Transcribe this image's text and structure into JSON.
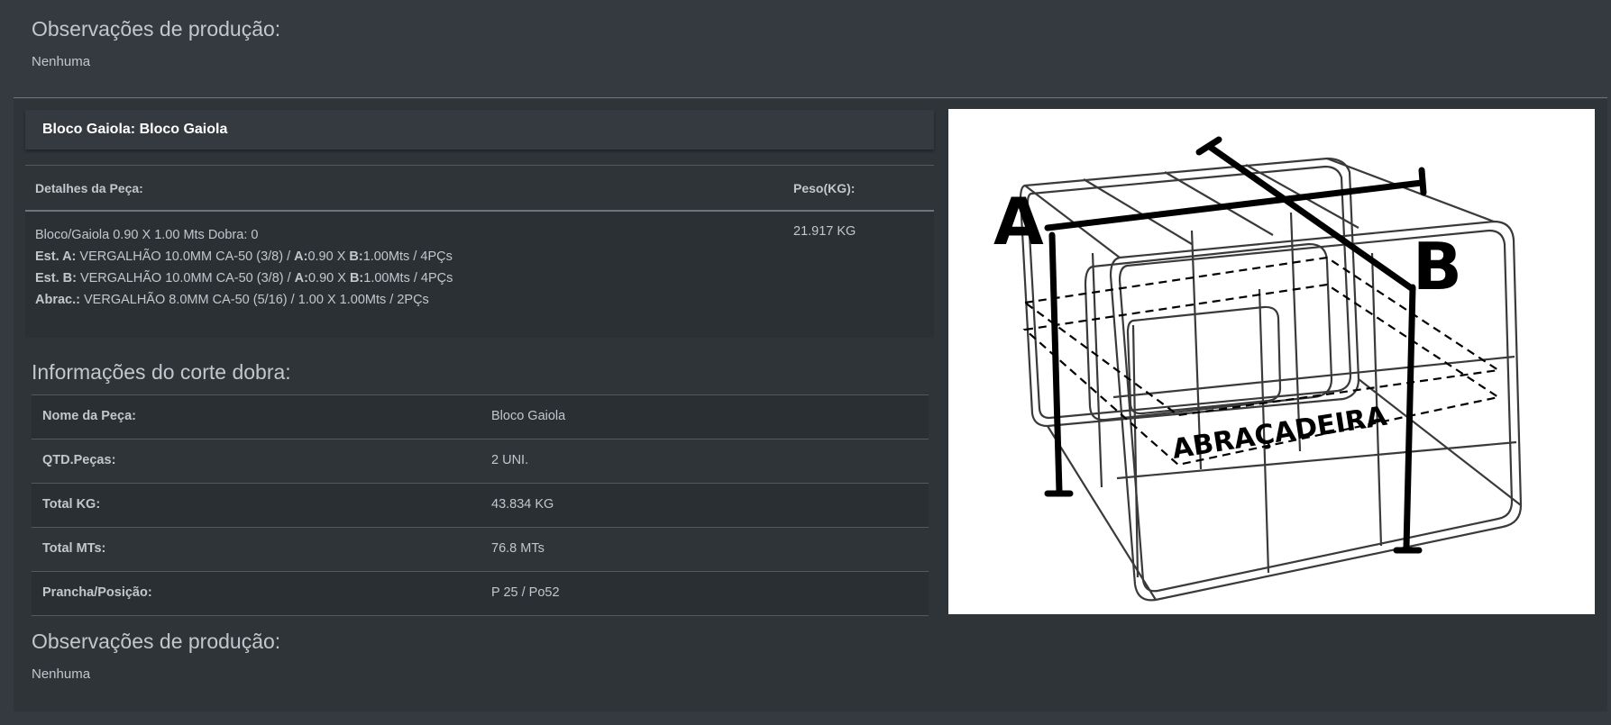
{
  "observacoes_top": {
    "title": "Observações de produção:",
    "text": "Nenhuma"
  },
  "block": {
    "title": "Bloco Gaiola: Bloco Gaiola"
  },
  "details": {
    "header_piece": "Detalhes da Peça:",
    "header_weight": "Peso(KG):",
    "line1": "Bloco/Gaiola 0.90 X 1.00 Mts Dobra: 0",
    "line2": {
      "label": "Est. A:",
      "text1": "VERGALHÃO 10.0MM CA-50 (3/8) /",
      "a_label": "A:",
      "a_val": "0.90 X",
      "b_label": "B:",
      "b_val": "1.00Mts / 4PÇs"
    },
    "line3": {
      "label": "Est. B:",
      "text1": "VERGALHÃO 10.0MM CA-50 (3/8) /",
      "a_label": "A:",
      "a_val": "0.90 X",
      "b_label": "B:",
      "b_val": "1.00Mts / 4PÇs"
    },
    "line4": {
      "label": "Abrac.:",
      "text1": "VERGALHÃO 8.0MM CA-50 (5/16) / 1.00 X 1.00Mts / 2PÇs"
    },
    "weight": "21.917 KG"
  },
  "info": {
    "title": "Informações do corte dobra:",
    "rows": [
      {
        "label": "Nome da Peça:",
        "value": "Bloco Gaiola"
      },
      {
        "label": "QTD.Peças:",
        "value": "2 UNI."
      },
      {
        "label": "Total KG:",
        "value": "43.834 KG"
      },
      {
        "label": "Total MTs:",
        "value": "76.8 MTs"
      },
      {
        "label": "Prancha/Posição:",
        "value": "P 25 / Po52"
      }
    ]
  },
  "image": {
    "label_a": "A",
    "label_b": "B",
    "label_clamp": "ABRAÇADEIRA"
  },
  "observacoes_bottom": {
    "title": "Observações de produção:",
    "text": "Nenhuma"
  }
}
